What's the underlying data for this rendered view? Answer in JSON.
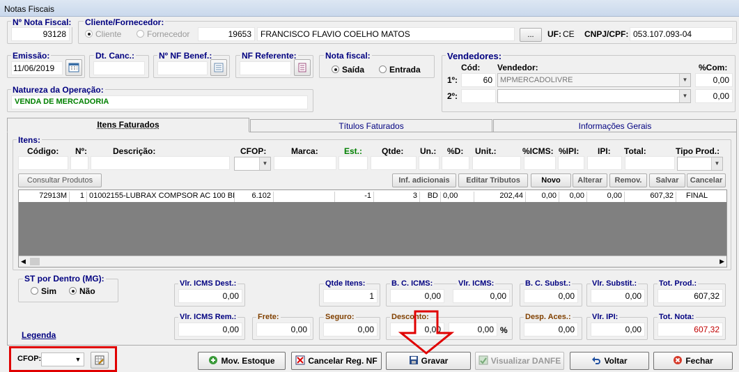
{
  "window": {
    "title": "Notas Fiscais"
  },
  "header": {
    "nf_label": "Nº Nota Fiscal:",
    "nf_value": "93128",
    "cliente_label": "Cliente/Fornecedor:",
    "opt_cliente": "Cliente",
    "opt_fornecedor": "Fornecedor",
    "cliente_code": "19653",
    "cliente_name": "FRANCISCO FLAVIO COELHO MATOS",
    "lookup_btn": "...",
    "uf_label": "UF:",
    "uf_value": "CE",
    "cnpj_label": "CNPJ/CPF:",
    "cnpj_value": "053.107.093-04"
  },
  "dates": {
    "emissao_label": "Emissão:",
    "emissao_value": "11/06/2019",
    "dtcanc_label": "Dt. Canc.:",
    "nfbenef_label": "Nº NF Benef.:",
    "nfref_label": "NF Referente:",
    "notafiscal_label": "Nota fiscal:",
    "opt_saida": "Saída",
    "opt_entrada": "Entrada"
  },
  "natureza": {
    "label": "Natureza da Operação:",
    "value": "VENDA DE MERCADORIA"
  },
  "vendedores": {
    "label": "Vendedores:",
    "cod_label": "Cód:",
    "vendedor_label": "Vendedor:",
    "com_label": "%Com:",
    "row1_label": "1º:",
    "row1_cod": "60",
    "row1_name": "MPMERCADOLIVRE",
    "row1_com": "0,00",
    "row2_label": "2º:",
    "row2_com": "0,00"
  },
  "tabs": [
    "Itens Faturados",
    "Títulos Faturados",
    "Informações Gerais"
  ],
  "itens": {
    "label": "Itens:",
    "headers": {
      "codigo": "Código:",
      "n": "Nº:",
      "descricao": "Descrição:",
      "cfop": "CFOP:",
      "marca": "Marca:",
      "est": "Est.:",
      "qtde": "Qtde:",
      "un": "Un.:",
      "pd": "%D:",
      "unit": "Unit.:",
      "icms": "%ICMS:",
      "ipi": "%IPI:",
      "ipiv": "IPI:",
      "total": "Total:",
      "tipo": "Tipo Prod.:"
    },
    "buttons": {
      "consultar": "Consultar Produtos",
      "inf": "Inf. adicionais",
      "editar": "Editar Tributos",
      "novo": "Novo",
      "alterar": "Alterar",
      "remov": "Remov.",
      "salvar": "Salvar",
      "cancelar": "Cancelar"
    },
    "row": {
      "codigo": "72913M",
      "n": "1",
      "descricao": "01002155-LUBRAX COMPSOR AC 100 BI",
      "cfop": "6.102",
      "marca": "",
      "est": "-1",
      "qtde": "3",
      "un": "BD",
      "pd": "0,00",
      "unit": "202,44",
      "icms": "0,00",
      "ipi": "0,00",
      "ipiv": "0,00",
      "total": "607,32",
      "tipo": "FINAL"
    }
  },
  "st": {
    "label": "ST por Dentro (MG):",
    "sim": "Sim",
    "nao": "Não"
  },
  "totals": {
    "vlr_icms_dest_label": "Vlr. ICMS Dest.:",
    "vlr_icms_dest": "0,00",
    "qtde_itens_label": "Qtde Itens:",
    "qtde_itens": "1",
    "bc_icms_label": "B. C. ICMS:",
    "bc_icms": "0,00",
    "vlr_icms_label": "Vlr. ICMS:",
    "vlr_icms": "0,00",
    "bc_subst_label": "B. C. Subst.:",
    "bc_subst": "0,00",
    "vlr_subst_label": "Vlr. Substit.:",
    "vlr_subst": "0,00",
    "tot_prod_label": "Tot. Prod.:",
    "tot_prod": "607,32",
    "vlr_icms_rem_label": "Vlr. ICMS Rem.:",
    "vlr_icms_rem": "0,00",
    "frete_label": "Frete:",
    "frete": "0,00",
    "seguro_label": "Seguro:",
    "seguro": "0,00",
    "desconto_label": "Desconto:",
    "desconto": "0,00",
    "desconto_pct": "0,00",
    "pct_sign": "%",
    "desp_label": "Desp. Aces.:",
    "desp": "0,00",
    "vlr_ipi_label": "Vlr. IPI:",
    "vlr_ipi": "0,00",
    "tot_nota_label": "Tot. Nota:",
    "tot_nota": "607,32"
  },
  "legenda": "Legenda",
  "footer": {
    "cfop_label": "CFOP:",
    "mov": "Mov. Estoque",
    "cancelar_reg": "Cancelar Reg. NF",
    "gravar": "Gravar",
    "danfe": "Visualizar DANFE",
    "voltar": "Voltar",
    "fechar": "Fechar"
  }
}
